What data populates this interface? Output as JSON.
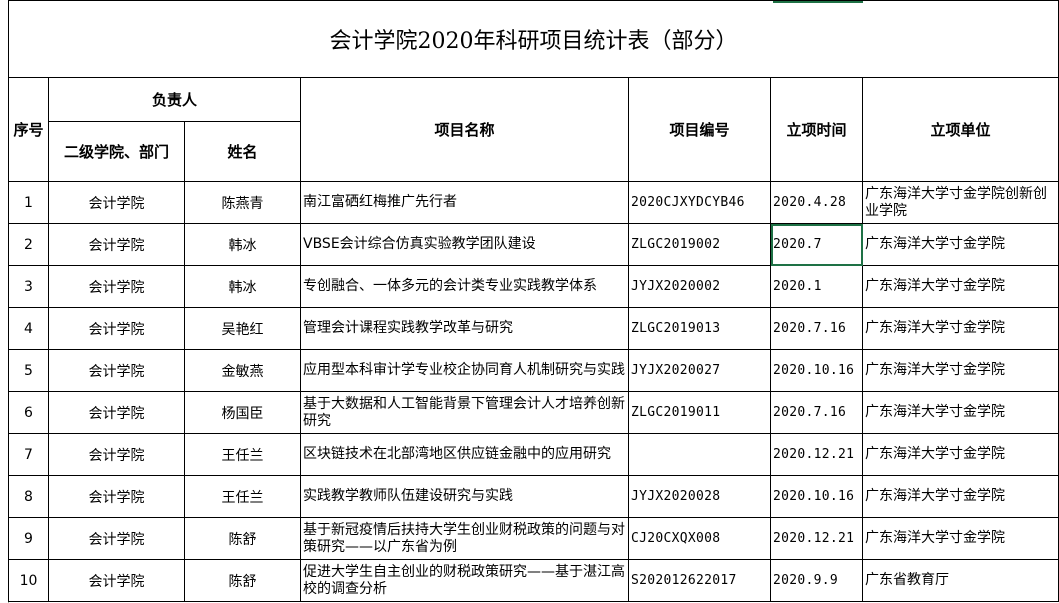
{
  "title": "会计学院2020年科研项目统计表（部分）",
  "headers": {
    "seq": "序号",
    "person": "负责人",
    "dept": "二级学院、部门",
    "name": "姓名",
    "project_name": "项目名称",
    "project_no": "项目编号",
    "date": "立项时间",
    "unit": "立项单位"
  },
  "rows": [
    {
      "seq": "1",
      "dept": "会计学院",
      "name": "陈燕青",
      "project": "南江富硒红梅推广先行者",
      "no": "2020CJXYDCYB46",
      "date": "2020.4.28",
      "unit": "广东海洋大学寸金学院创新创业学院"
    },
    {
      "seq": "2",
      "dept": "会计学院",
      "name": "韩冰",
      "project": "VBSE会计综合仿真实验教学团队建设",
      "no": "ZLGC2019002",
      "date": "2020.7",
      "unit": "广东海洋大学寸金学院"
    },
    {
      "seq": "3",
      "dept": "会计学院",
      "name": "韩冰",
      "project": "专创融合、一体多元的会计类专业实践教学体系",
      "no": "JYJX2020002",
      "date": "2020.1",
      "unit": "广东海洋大学寸金学院"
    },
    {
      "seq": "4",
      "dept": "会计学院",
      "name": "吴艳红",
      "project": "管理会计课程实践教学改革与研究",
      "no": "ZLGC2019013",
      "date": "2020.7.16",
      "unit": "广东海洋大学寸金学院"
    },
    {
      "seq": "5",
      "dept": "会计学院",
      "name": "金敏燕",
      "project": "应用型本科审计学专业校企协同育人机制研究与实践",
      "no": "JYJX2020027",
      "date": "2020.10.16",
      "unit": "广东海洋大学寸金学院"
    },
    {
      "seq": "6",
      "dept": "会计学院",
      "name": "杨国臣",
      "project": "基于大数据和人工智能背景下管理会计人才培养创新研究",
      "no": "ZLGC2019011",
      "date": "2020.7.16",
      "unit": "广东海洋大学寸金学院"
    },
    {
      "seq": "7",
      "dept": "会计学院",
      "name": "王任兰",
      "project": "区块链技术在北部湾地区供应链金融中的应用研究",
      "no": "",
      "date": "2020.12.21",
      "unit": "广东海洋大学寸金学院"
    },
    {
      "seq": "8",
      "dept": "会计学院",
      "name": "王任兰",
      "project": "实践教学教师队伍建设研究与实践",
      "no": "JYJX2020028",
      "date": "2020.10.16",
      "unit": "广东海洋大学寸金学院"
    },
    {
      "seq": "9",
      "dept": "会计学院",
      "name": "陈舒",
      "project": "基于新冠疫情后扶持大学生创业财税政策的问题与对策研究——以广东省为例",
      "no": "CJ20CXQX008",
      "date": "2020.12.21",
      "unit": "广东海洋大学寸金学院"
    },
    {
      "seq": "10",
      "dept": "会计学院",
      "name": "陈舒",
      "project": "促进大学生自主创业的财税政策研究——基于湛江高校的调查分析",
      "no": "S202012622017",
      "date": "2020.9.9",
      "unit": "广东省教育厅"
    }
  ]
}
